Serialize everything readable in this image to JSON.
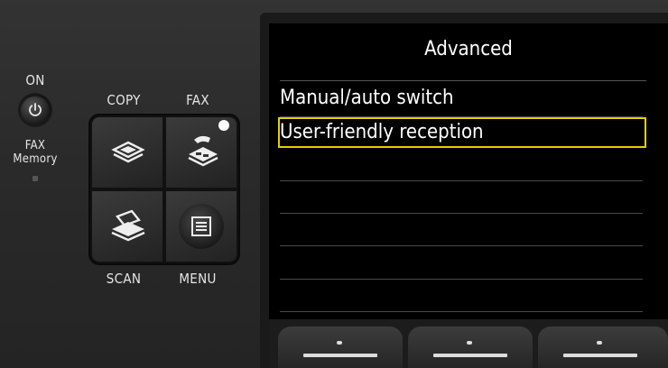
{
  "control_panel": {
    "on_label": "ON",
    "fax_memory_label_line1": "FAX",
    "fax_memory_label_line2": "Memory",
    "copy_label": "COPY",
    "fax_label": "FAX",
    "scan_label": "SCAN",
    "menu_label": "MENU",
    "icons": {
      "power": "power-icon",
      "copy": "copy-icon",
      "fax": "fax-icon",
      "scan": "scan-icon",
      "menu": "menu-list-icon"
    }
  },
  "screen": {
    "title": "Advanced",
    "items": [
      {
        "label": "Manual/auto switch",
        "selected": false
      },
      {
        "label": "User-friendly reception",
        "selected": true
      }
    ],
    "selection_color": "#e4d000"
  }
}
